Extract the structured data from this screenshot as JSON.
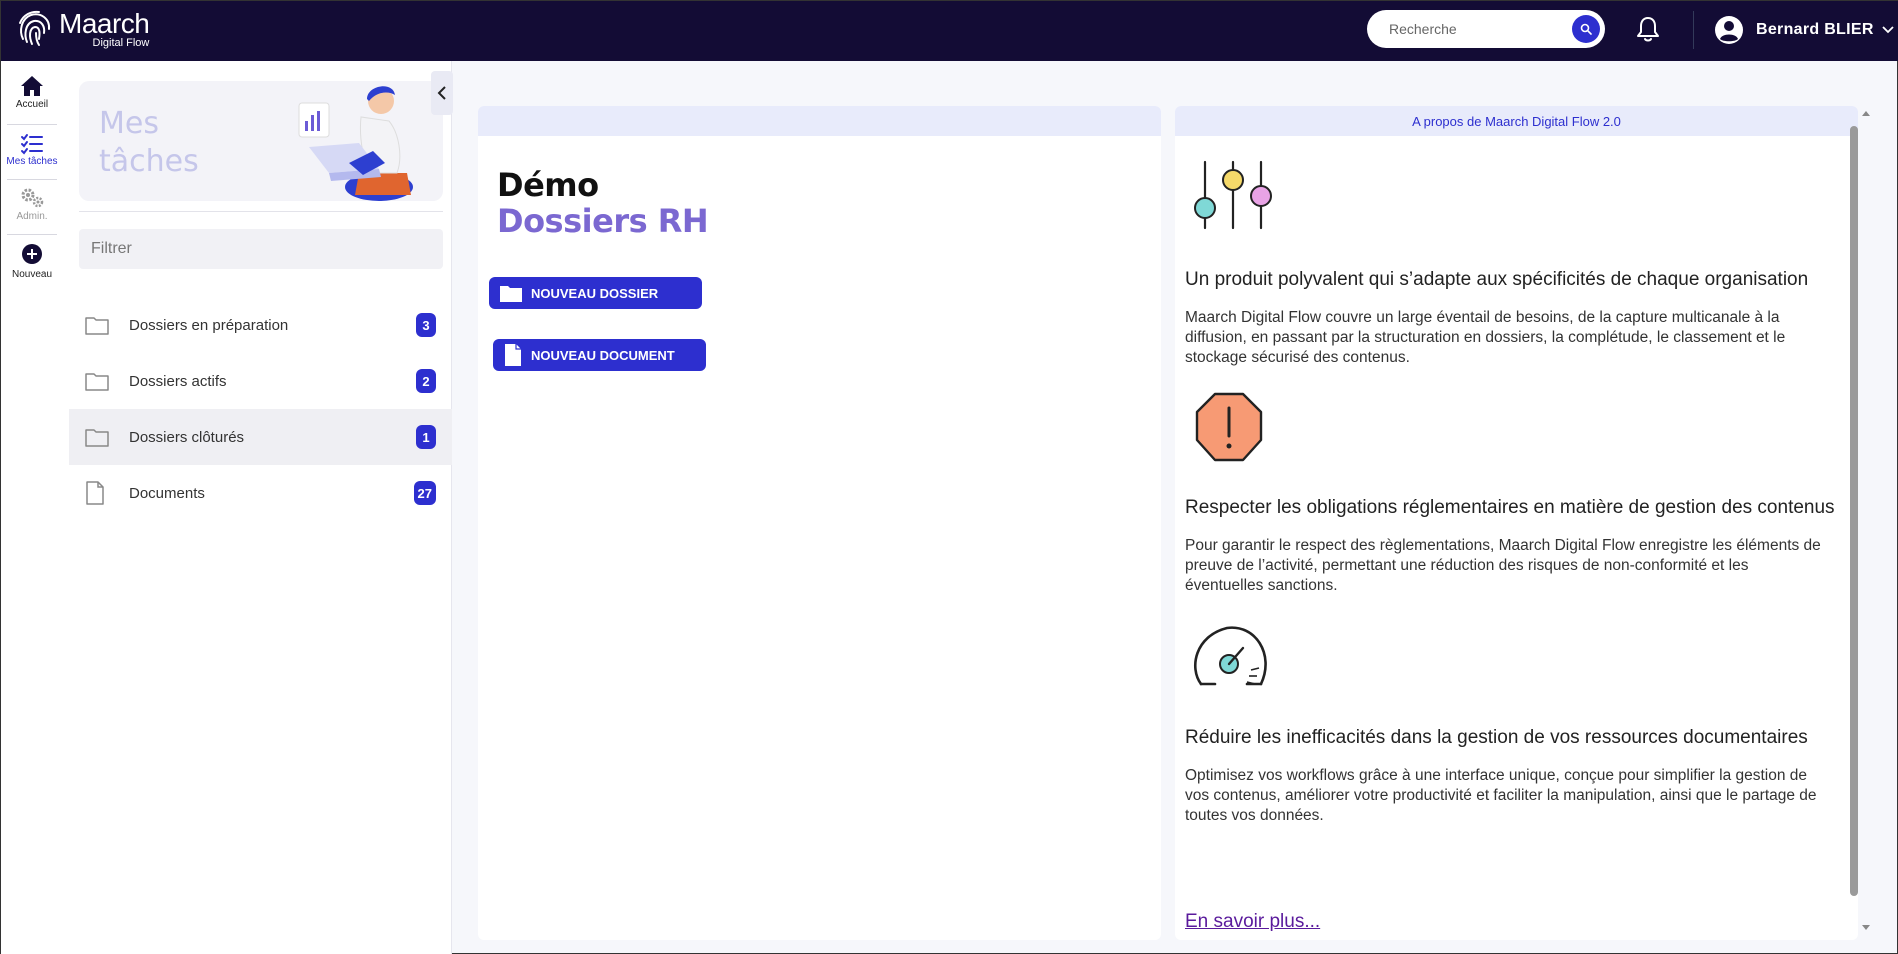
{
  "header": {
    "logo_name": "Maarch",
    "logo_sub": "Digital Flow",
    "search_placeholder": "Recherche",
    "user_name": "Bernard BLIER"
  },
  "rail": {
    "items": [
      {
        "label": "Accueil",
        "icon": "home-icon"
      },
      {
        "label": "Mes tâches",
        "icon": "checklist-icon"
      },
      {
        "label": "Admin.",
        "icon": "gears-icon"
      },
      {
        "label": "Nouveau",
        "icon": "plus-circle-icon"
      }
    ]
  },
  "tasks": {
    "title_line1": "Mes",
    "title_line2": "tâches",
    "filter_placeholder": "Filtrer",
    "items": [
      {
        "label": "Dossiers en préparation",
        "count": "3",
        "icon": "folder-icon"
      },
      {
        "label": "Dossiers actifs",
        "count": "2",
        "icon": "folder-icon"
      },
      {
        "label": "Dossiers clôturés",
        "count": "1",
        "icon": "folder-icon"
      },
      {
        "label": "Documents",
        "count": "27",
        "icon": "document-icon"
      }
    ]
  },
  "demo": {
    "title": "Démo",
    "subtitle": "Dossiers RH",
    "btn_folder": "NOUVEAU DOSSIER",
    "btn_document": "NOUVEAU DOCUMENT"
  },
  "about": {
    "header": "A propos de Maarch Digital Flow 2.0",
    "features": [
      {
        "title": "Un produit polyvalent qui s’adapte aux spécificités de chaque organisation",
        "text": "Maarch Digital Flow couvre un large éventail de besoins, de la capture multicanale à la diffusion, en passant par la structuration en dossiers, la complétude, le classement et le stockage sécurisé des contenus.",
        "icon": "sliders-icon"
      },
      {
        "title": "Respecter les obligations réglementaires en matière de gestion des contenus",
        "text": "Pour garantir le respect des règlementations, Maarch Digital Flow enregistre les éléments de preuve de l’activité, permettant une réduction des risques de non-conformité et les éventuelles sanctions.",
        "icon": "warning-octagon-icon"
      },
      {
        "title": "Réduire les inefficacités dans la gestion de vos ressources documentaires",
        "text": "Optimisez vos workflows grâce à une interface unique, conçue pour simplifier la gestion de vos contenus, améliorer votre productivité et faciliter la manipulation, ainsi que le partage de toutes vos données.",
        "icon": "gauge-icon"
      }
    ],
    "more_link": "En savoir plus..."
  },
  "colors": {
    "topbar": "#130c35",
    "accent": "#2d2fcf",
    "subtitle": "#7b68d1",
    "link": "#5a1a9c"
  }
}
